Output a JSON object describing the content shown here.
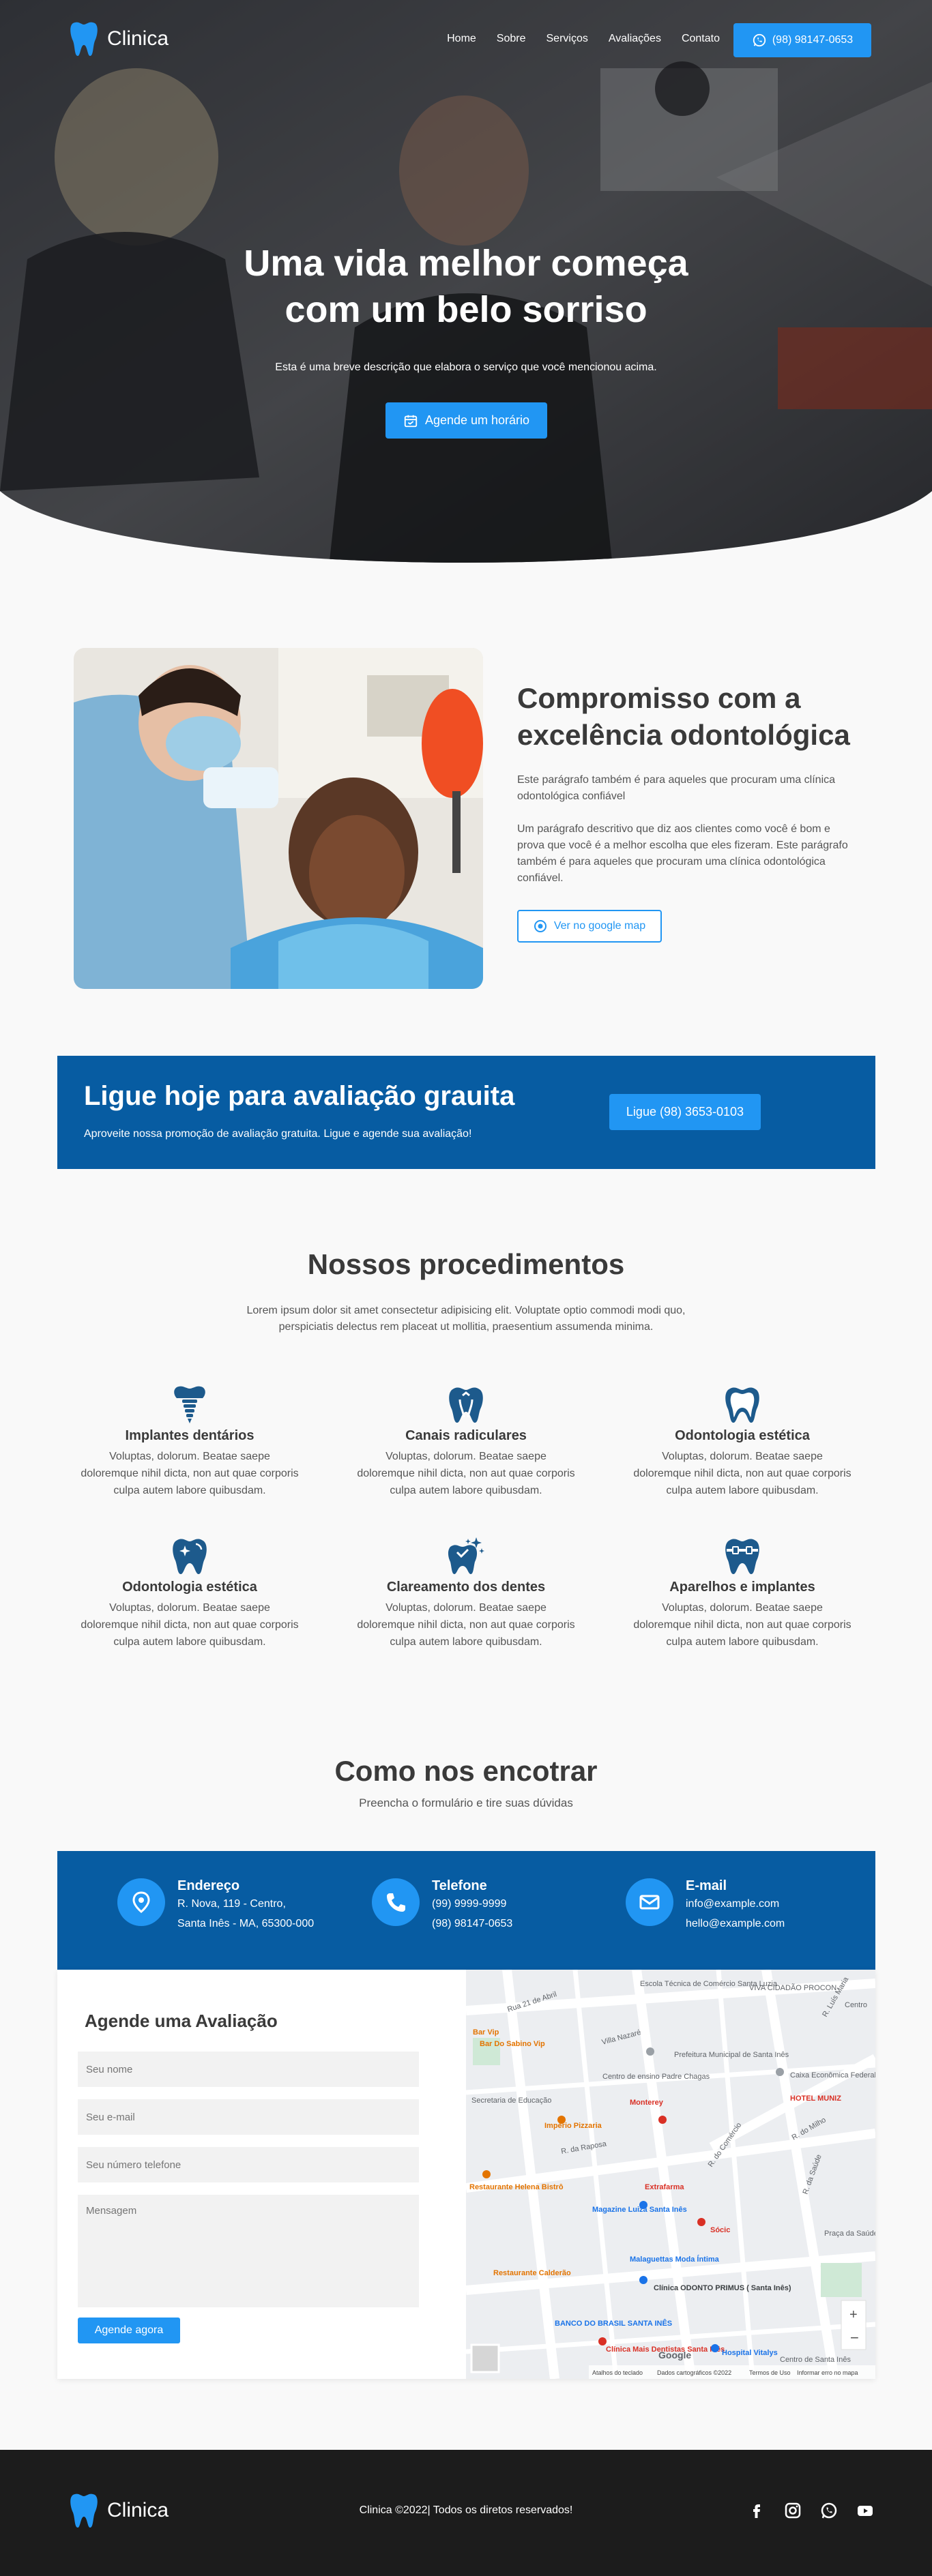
{
  "colors": {
    "primary": "#2196f3",
    "dark_blue": "#075ca2",
    "footer": "#1c1c1c",
    "icon_blue": "#1d5a8c"
  },
  "nav": {
    "logo": "Clinica",
    "links": [
      "Home",
      "Sobre",
      "Serviços",
      "Avaliações",
      "Contato"
    ],
    "phone": "(98) 98147-0653"
  },
  "hero": {
    "title": "Uma vida melhor começa com um belo sorriso",
    "subtitle": "Esta é uma breve descrição que elabora o serviço que você mencionou acima.",
    "cta": "Agende um horário"
  },
  "about": {
    "title": "Compromisso com a excelência odontológica",
    "p1": "Este parágrafo também é para aqueles que procuram uma clínica odontológica confiável",
    "p2": "Um parágrafo descritivo que diz aos clientes como você é bom e prova que você é a melhor escolha que eles fizeram. Este parágrafo também é para aqueles que procuram uma clínica odontológica confiável.",
    "map_button": "Ver no google map"
  },
  "cta": {
    "title": "Ligue hoje para avaliação grauita",
    "subtitle": "Aproveite nossa promoção de avaliação gratuita. Ligue e agende sua avaliação!",
    "button": "Ligue (98) 3653-0103"
  },
  "procedures": {
    "title": "Nossos procedimentos",
    "subtitle": "Lorem ipsum dolor sit amet consectetur adipisicing elit. Voluptate optio commodi modi quo, perspiciatis delectus rem placeat ut mollitia, praesentium assumenda minima.",
    "items": [
      {
        "name": "Implantes dentários",
        "desc": "Voluptas, dolorum. Beatae saepe doloremque nihil dicta, non aut quae corporis culpa autem labore quibusdam.",
        "icon": "dental-implant-icon"
      },
      {
        "name": "Canais radiculares",
        "desc": "Voluptas, dolorum. Beatae saepe doloremque nihil dicta, non aut quae corporis culpa autem labore quibusdam.",
        "icon": "root-canal-icon"
      },
      {
        "name": "Odontologia estética",
        "desc": "Voluptas, dolorum. Beatae saepe doloremque nihil dicta, non aut quae corporis culpa autem labore quibusdam.",
        "icon": "tooth-outline-icon"
      },
      {
        "name": "Odontologia estética",
        "desc": "Voluptas, dolorum. Beatae saepe doloremque nihil dicta, non aut quae corporis culpa autem labore quibusdam.",
        "icon": "tooth-sparkle-icon"
      },
      {
        "name": "Clareamento dos dentes",
        "desc": "Voluptas, dolorum. Beatae saepe doloremque nihil dicta, non aut quae corporis culpa autem labore quibusdam.",
        "icon": "tooth-whitening-icon"
      },
      {
        "name": "Aparelhos e implantes",
        "desc": "Voluptas, dolorum. Beatae saepe doloremque nihil dicta, non aut quae corporis culpa autem labore quibusdam.",
        "icon": "braces-icon"
      }
    ]
  },
  "contact": {
    "title": "Como nos encotrar",
    "subtitle": "Preencha o formulário e tire suas dúvidas",
    "address": {
      "label": "Endereço",
      "line1": "R. Nova, 119 - Centro,",
      "line2": "Santa Inês - MA, 65300-000"
    },
    "phone": {
      "label": "Telefone",
      "line1": "(99) 9999-9999",
      "line2": "(98) 98147-0653"
    },
    "email": {
      "label": "E-mail",
      "line1": "info@example.com",
      "line2": "hello@example.com"
    },
    "form": {
      "title": "Agende uma Avaliação",
      "name_placeholder": "Seu nome",
      "email_placeholder": "Seu e-mail",
      "phone_placeholder": "Seu número telefone",
      "message_placeholder": "Mensagem",
      "submit": "Agende agora"
    },
    "map": {
      "labels": [
        "Escola Técnica de Comércio Santa Luzia",
        "VIVA CIDADÃO PROCON",
        "Centro",
        "R. Luís Maria",
        "Rua 21 de Abril",
        "Bar Do Sabino Vip",
        "Bar Vip",
        "Villa Nazaré",
        "Prefeitura Municipal de Santa Inês",
        "Caixa Econômica Federal",
        "Centro de ensino Padre Chagas",
        "HOTEL MUNIZ",
        "Secretaria de Educação",
        "Monterey",
        "Império Pizzaria",
        "R. da Raposa",
        "R. do Comércio",
        "R. do Milho",
        "Restaurante Helena Bistrô",
        "Extrafarma",
        "Magazine Luiza Santa Inês",
        "Sócic",
        "R. da Saúde",
        "Praça da Saúde",
        "Restaurante Calderão",
        "Malaguettas Moda Íntima",
        "Clínica ODONTO PRIMUS ( Santa Inês)",
        "BANCO DO BRASIL SANTA INÊS",
        "Clínica Mais Dentistas Santa Inês",
        "Hospital Vitalys",
        "Centro de Santa Inês",
        "Atalhos do teclado",
        "Dados cartográficos ©2022",
        "Termos de Uso",
        "Informar erro no mapa",
        "Google"
      ]
    }
  },
  "footer": {
    "logo": "Clinica",
    "copyright": "Clinica ©2022| Todos os diretos reservados!",
    "socials": [
      "facebook-icon",
      "instagram-icon",
      "whatsapp-icon",
      "youtube-icon"
    ]
  }
}
